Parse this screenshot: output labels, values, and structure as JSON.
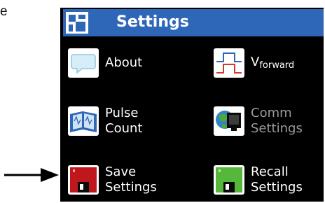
{
  "doc_fragment": "e",
  "header": {
    "title": "Settings",
    "icon": "settings-app-icon",
    "color": "#2f67b8"
  },
  "items": [
    {
      "id": "about",
      "icon": "speech-bubble-icon",
      "label_lines": [
        "About"
      ],
      "enabled": true
    },
    {
      "id": "vforward",
      "icon": "pulse-waveform-icon",
      "label_main": "V",
      "label_sub": "forward",
      "enabled": true
    },
    {
      "id": "pulse-count",
      "icon": "pulse-book-icon",
      "label_lines": [
        "Pulse",
        "Count"
      ],
      "enabled": true
    },
    {
      "id": "comm-settings",
      "icon": "globe-monitor-icon",
      "label_lines": [
        "Comm",
        "Settings"
      ],
      "enabled": false
    },
    {
      "id": "save-settings",
      "icon": "red-floppy-disk-icon",
      "label_lines": [
        "Save",
        "Settings"
      ],
      "enabled": true,
      "highlighted": true
    },
    {
      "id": "recall-settings",
      "icon": "green-floppy-disk-icon",
      "label_lines": [
        "Recall",
        "Settings"
      ],
      "enabled": true
    }
  ],
  "colors": {
    "screen_bg": "#000000",
    "save_disk": "#c0171d",
    "recall_disk": "#55b83a",
    "disabled_text": "#9a9a9a"
  }
}
